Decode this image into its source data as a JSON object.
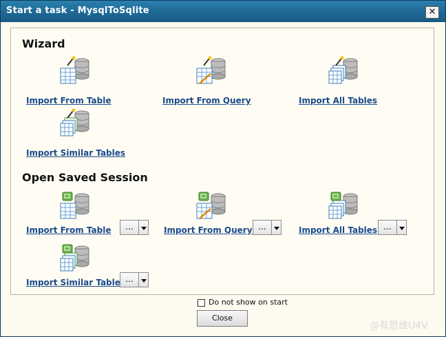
{
  "window": {
    "title": "Start a task - MysqlToSqlite",
    "close_glyph": "✕"
  },
  "wizard": {
    "heading": "Wizard",
    "items": [
      {
        "label": "Import From Table",
        "icon": "table-db-wand-icon"
      },
      {
        "label": "Import From Query",
        "icon": "query-db-wand-icon"
      },
      {
        "label": "Import All Tables",
        "icon": "tables-db-wand-icon"
      },
      {
        "label": "Import Similar Tables",
        "icon": "similar-tables-db-wand-icon"
      }
    ]
  },
  "saved_session": {
    "heading": "Open Saved Session",
    "items": [
      {
        "label": "Import From Table",
        "icon": "table-db-session-icon"
      },
      {
        "label": "Import From Query",
        "icon": "query-db-session-icon"
      },
      {
        "label": "Import All Tables",
        "icon": "tables-db-session-icon"
      },
      {
        "label": "Import Similar Tables",
        "icon": "similar-tables-db-session-icon"
      }
    ],
    "split_button_label": "..."
  },
  "footer": {
    "checkbox_label": "Do not show on start",
    "checkbox_checked": false,
    "close_label": "Close"
  },
  "watermark": "@有思维U4V",
  "colors": {
    "title_bar": "#1f6b98",
    "link": "#1a4a8c",
    "panel_bg": "#fffdf3"
  }
}
